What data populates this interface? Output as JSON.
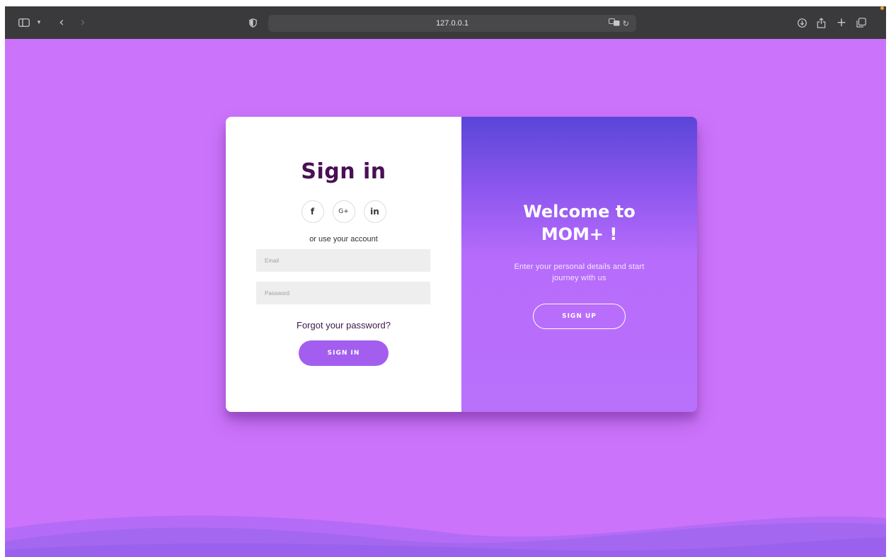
{
  "browser": {
    "url": "127.0.0.1",
    "icons": {
      "sidebar": "sidebar-icon",
      "dropdown": "chevron-down-icon",
      "back": "chevron-left-icon",
      "forward": "chevron-right-icon",
      "privacy": "shield-icon",
      "translate": "translate-icon",
      "reload": "reload-icon",
      "download": "download-icon",
      "share": "share-icon",
      "new_tab": "plus-icon",
      "tabs": "tabs-icon"
    },
    "colors": {
      "toolbar": "#3a3a3c",
      "notification_dot": "#f29a3a"
    }
  },
  "page": {
    "background": "#cc73fb"
  },
  "signin": {
    "title": "Sign in",
    "social": {
      "facebook": "f",
      "google": "G+",
      "linkedin": "in"
    },
    "or_text": "or use your account",
    "email_placeholder": "Email",
    "password_placeholder": "Password",
    "forgot_link": "Forgot your password?",
    "submit_label": "SIGN IN",
    "title_color": "#4a0f55",
    "button_color": "#a35ef0"
  },
  "welcome": {
    "title_line1": "Welcome to",
    "title_line2": "MOM+ !",
    "subtitle_line1": "Enter your personal details and start",
    "subtitle_line2": "journey with us",
    "signup_label": "SIGN UP"
  }
}
